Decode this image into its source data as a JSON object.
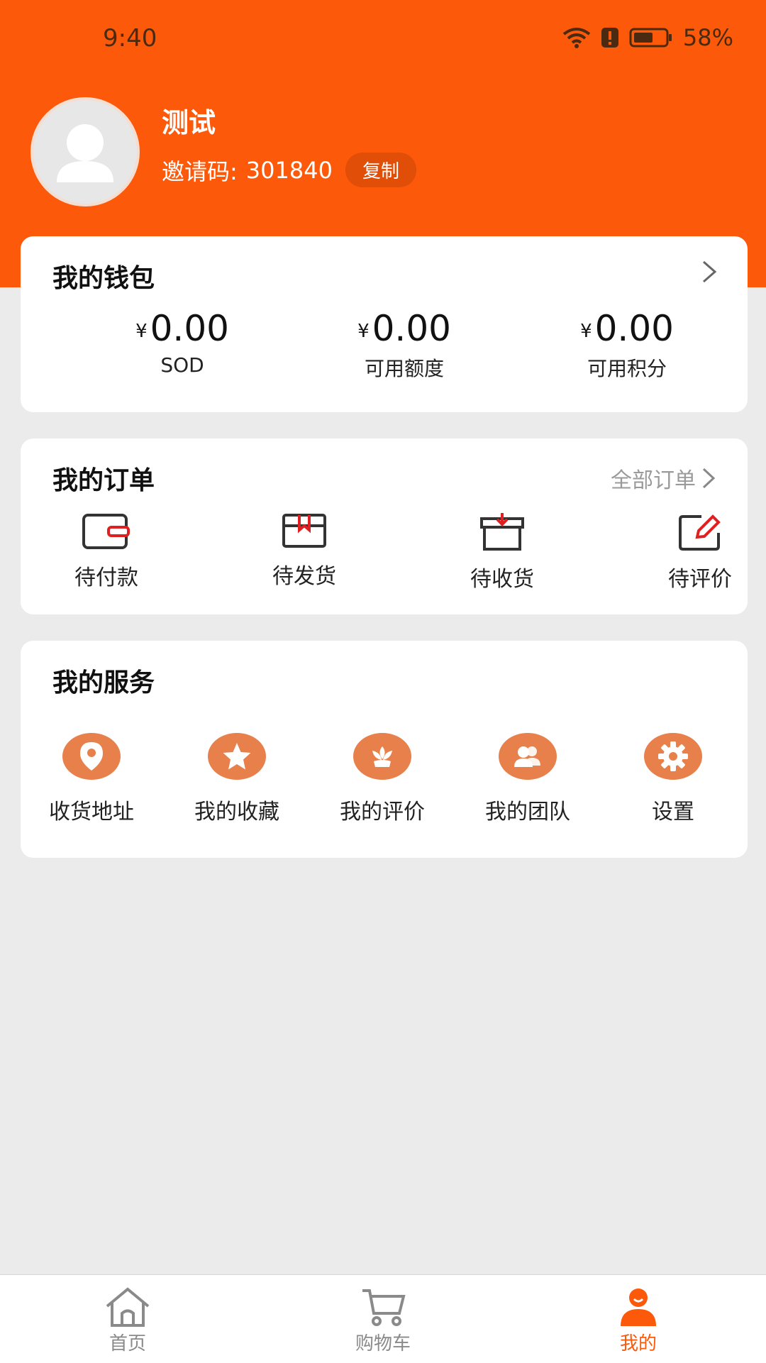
{
  "status_bar": {
    "time": "9:40",
    "battery": "58%"
  },
  "profile": {
    "name": "测试",
    "invite_label": "邀请码:",
    "invite_code": "301840",
    "copy_label": "复制"
  },
  "wallet": {
    "title": "我的钱包",
    "currency_symbol": "¥",
    "items": [
      {
        "amount": "0.00",
        "label": "SOD"
      },
      {
        "amount": "0.00",
        "label": "可用额度"
      },
      {
        "amount": "0.00",
        "label": "可用积分"
      }
    ]
  },
  "orders": {
    "title": "我的订单",
    "all_label": "全部订单",
    "items": [
      {
        "label": "待付款",
        "icon": "wallet-icon"
      },
      {
        "label": "待发货",
        "icon": "package-icon"
      },
      {
        "label": "待收货",
        "icon": "receive-box-icon"
      },
      {
        "label": "待评价",
        "icon": "edit-review-icon"
      }
    ]
  },
  "services": {
    "title": "我的服务",
    "items": [
      {
        "label": "收货地址",
        "icon": "location-pin-icon"
      },
      {
        "label": "我的收藏",
        "icon": "star-icon"
      },
      {
        "label": "我的评价",
        "icon": "flower-icon"
      },
      {
        "label": "我的团队",
        "icon": "team-icon"
      },
      {
        "label": "设置",
        "icon": "gear-icon"
      }
    ]
  },
  "bottom_nav": {
    "items": [
      {
        "label": "首页",
        "icon": "home-icon"
      },
      {
        "label": "购物车",
        "icon": "cart-icon"
      },
      {
        "label": "我的",
        "icon": "user-icon",
        "active": true
      }
    ]
  },
  "colors": {
    "brand": "#fc5a0a",
    "service_icon_bg": "#e7804a",
    "background": "#ebebeb"
  }
}
